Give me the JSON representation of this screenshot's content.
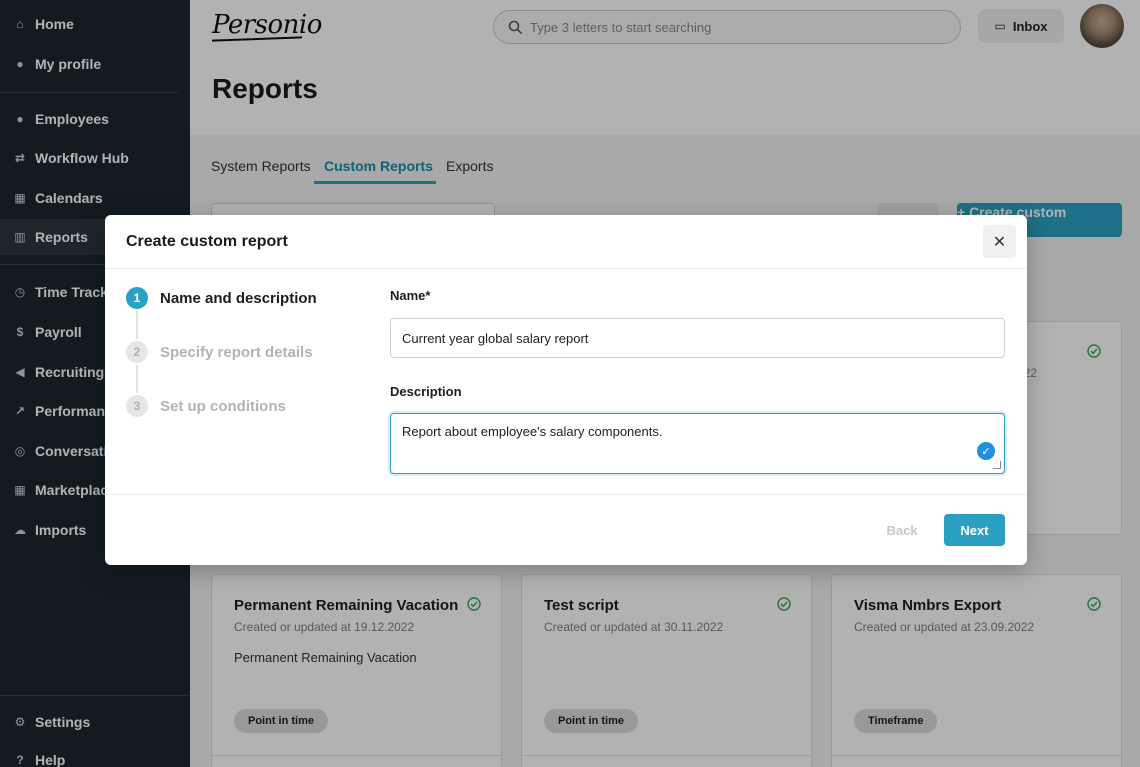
{
  "sidebar": {
    "items": [
      {
        "label": "Home",
        "icon": "home-icon"
      },
      {
        "label": "My profile",
        "icon": "user-icon"
      },
      {
        "label": "Employees",
        "icon": "people-icon"
      },
      {
        "label": "Workflow Hub",
        "icon": "workflow-icon"
      },
      {
        "label": "Calendars",
        "icon": "calendar-icon"
      },
      {
        "label": "Reports",
        "icon": "chart-icon"
      },
      {
        "label": "Time Tracking",
        "icon": "clock-icon"
      },
      {
        "label": "Payroll",
        "icon": "dollar-icon"
      },
      {
        "label": "Recruiting",
        "icon": "megaphone-icon"
      },
      {
        "label": "Performance",
        "icon": "trend-icon"
      },
      {
        "label": "Conversations",
        "icon": "chat-icon"
      },
      {
        "label": "Marketplace",
        "icon": "grid-icon"
      },
      {
        "label": "Imports",
        "icon": "cloud-upload-icon"
      },
      {
        "label": "Settings",
        "icon": "gear-icon"
      },
      {
        "label": "Help",
        "icon": "help-icon"
      }
    ]
  },
  "header": {
    "logo": "Personio",
    "search_placeholder": "Type 3 letters to start searching",
    "inbox_label": "Inbox",
    "page_title": "Reports"
  },
  "tabs": [
    {
      "label": "System Reports"
    },
    {
      "label": "Custom Reports"
    },
    {
      "label": "Exports"
    }
  ],
  "background": {
    "create_button_label": "+ Create custom report",
    "partial_card_fragment": "22",
    "cards": [
      {
        "title": "Permanent Remaining Vacation",
        "updated": "Created or updated at 19.12.2022",
        "description": "Permanent Remaining Vacation",
        "badge": "Point in time"
      },
      {
        "title": "Test script",
        "updated": "Created or updated at 30.11.2022",
        "description": "",
        "badge": "Point in time"
      },
      {
        "title": "Visma Nmbrs Export",
        "updated": "Created or updated at 23.09.2022",
        "description": "",
        "badge": "Timeframe"
      }
    ]
  },
  "modal": {
    "title": "Create custom report",
    "close_icon": "close-icon",
    "steps": [
      {
        "number": "1",
        "label": "Name and description",
        "active": true
      },
      {
        "number": "2",
        "label": "Specify report details",
        "active": false
      },
      {
        "number": "3",
        "label": "Set up conditions",
        "active": false
      }
    ],
    "name_label": "Name*",
    "name_value": "Current year global salary report",
    "description_label": "Description",
    "description_value": "Report about employee's salary components.",
    "back_label": "Back",
    "next_label": "Next"
  },
  "colors": {
    "accent": "#2aa1c2",
    "sidebar_bg": "#1c2730",
    "check_green": "#3aa35a"
  }
}
